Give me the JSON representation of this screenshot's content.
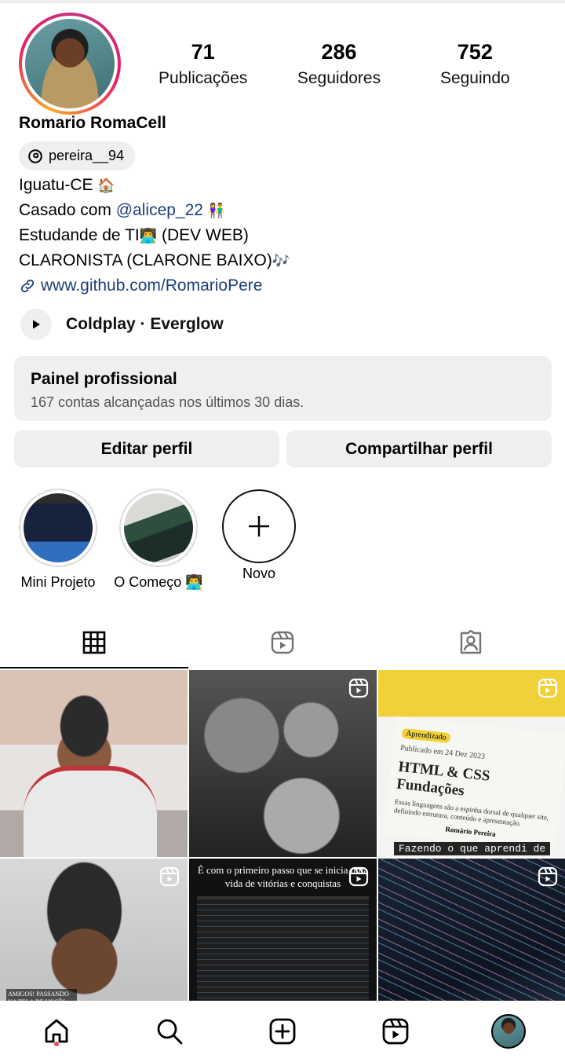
{
  "profile": {
    "name": "Romario RomaCell",
    "threads_handle": "pereira__94",
    "stats": [
      {
        "value": "71",
        "label": "Publicações"
      },
      {
        "value": "286",
        "label": "Seguidores"
      },
      {
        "value": "752",
        "label": "Seguindo"
      }
    ],
    "bio": {
      "line1": "Iguatu-CE",
      "line1_emoji": "🏠",
      "line2_prefix": "Casado com ",
      "line2_mention": "@alicep_22",
      "line2_emoji": "👫",
      "line3_prefix": "Estudande de TI",
      "line3_emoji": "👨‍💻",
      "line3_suffix": " (DEV WEB)",
      "line4": "CLARONISTA (CLARONE BAIXO)",
      "line4_emoji": "🎶",
      "link": "www.github.com/RomarioPere"
    },
    "music": "Coldplay · Everglow"
  },
  "panel": {
    "title": "Painel profissional",
    "subtitle": "167 contas alcançadas nos últimos 30 dias."
  },
  "buttons": {
    "edit": "Editar perfil",
    "share": "Compartilhar perfil"
  },
  "highlights": [
    {
      "label": "Mini Projeto"
    },
    {
      "label": "O Começo",
      "emoji": "👨‍💻"
    },
    {
      "label": "Novo"
    }
  ],
  "posts": {
    "post3": {
      "tag": "Aprendizado",
      "published": "Publicado em 24 Dez 2023",
      "title": "HTML & CSS Fundações",
      "text": "Essas linguagens são a espinha dorsal de qualquer site, definindo estrutura, conteúdo e apresentação.",
      "author": "Romário Pereira",
      "caption": "Fazendo o que aprendi de"
    },
    "post4": {
      "overlay": "AMIGOS! PASSANDO NA TELA DE VOCÊS PRA DIZER O JESUS AMA A TODOS INDEPENDENTEMENTE DE"
    },
    "post5": {
      "caption": "É com o primeiro passo que se inicia uma vida de vitórias e conquistas"
    }
  },
  "icons": {
    "threads": "threads-icon",
    "link": "link-icon",
    "play": "play-icon",
    "grid": "grid-icon",
    "reels": "reels-icon",
    "tagged": "tagged-icon",
    "home": "home-icon",
    "search": "search-icon",
    "create": "create-icon",
    "reels_nav": "reels-nav-icon",
    "profile": "profile-avatar"
  },
  "colors": {
    "link": "#1c3f7a",
    "chip_bg": "#efefef",
    "notification_dot": "#ed4956"
  }
}
